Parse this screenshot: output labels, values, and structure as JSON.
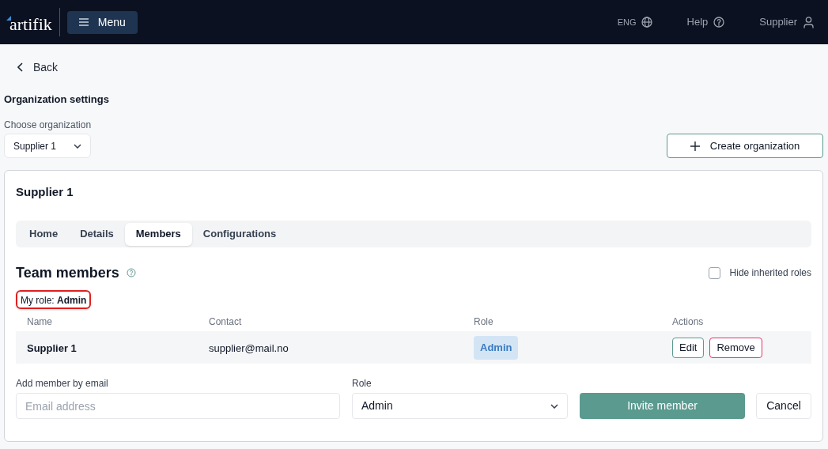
{
  "header": {
    "logo": "artifik",
    "menu_button": "Menu",
    "language": "ENG",
    "help": "Help",
    "user": "Supplier"
  },
  "back": "Back",
  "page_title": "Organization settings",
  "organization_picker": {
    "label": "Choose organization",
    "value": "Supplier 1"
  },
  "create_button": "Create organization",
  "card": {
    "title": "Supplier 1",
    "tabs": [
      {
        "label": "Home",
        "selected": false
      },
      {
        "label": "Details",
        "selected": false
      },
      {
        "label": "Members",
        "selected": true
      },
      {
        "label": "Configurations",
        "selected": false
      }
    ],
    "section_title": "Team members",
    "hide_inherited": {
      "label": "Hide inherited roles",
      "checked": false
    },
    "my_role": {
      "label": "My role:",
      "value": "Admin"
    },
    "table": {
      "columns": [
        "Name",
        "Contact",
        "Role",
        "Actions"
      ],
      "rows": [
        {
          "name": "Supplier 1",
          "contact": "supplier@mail.no",
          "role": "Admin",
          "actions": [
            "Edit",
            "Remove"
          ]
        }
      ]
    },
    "invite_form": {
      "email_label": "Add member by email",
      "email_placeholder": "Email address",
      "role_label": "Role",
      "role_value": "Admin",
      "invite_button": "Invite member",
      "cancel_button": "Cancel"
    }
  }
}
